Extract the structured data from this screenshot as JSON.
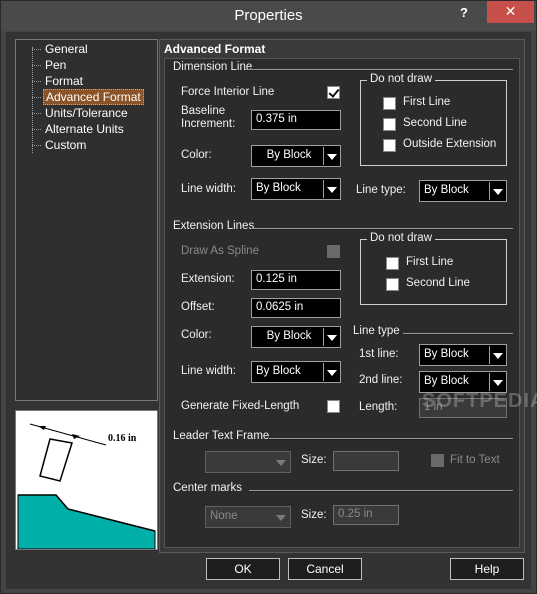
{
  "window": {
    "title": "Properties",
    "help_glyph": "?",
    "close_glyph": "✕"
  },
  "tree": {
    "items": [
      {
        "label": "General",
        "selected": false
      },
      {
        "label": "Pen",
        "selected": false
      },
      {
        "label": "Format",
        "selected": false
      },
      {
        "label": "Advanced Format",
        "selected": true
      },
      {
        "label": "Units/Tolerance",
        "selected": false
      },
      {
        "label": "Alternate Units",
        "selected": false
      },
      {
        "label": "Custom",
        "selected": false
      }
    ]
  },
  "preview": {
    "dimension_text": "0.16 in",
    "fill_color": "#00b0a8"
  },
  "panel": {
    "title": "Advanced Format",
    "dimension_line": {
      "heading": "Dimension Line",
      "force_interior_label": "Force Interior Line",
      "force_interior_checked": true,
      "baseline_label_1": "Baseline",
      "baseline_label_2": "Increment:",
      "baseline_value": "0.375 in",
      "color_label": "Color:",
      "color_value": "By Block",
      "line_width_label": "Line width:",
      "line_width_value": "By Block",
      "line_type_label": "Line type:",
      "line_type_value": "By Block",
      "do_not_draw": {
        "caption": "Do not draw",
        "first_line": "First Line",
        "second_line": "Second Line",
        "outside_extension": "Outside Extension"
      }
    },
    "extension_lines": {
      "heading": "Extension Lines",
      "draw_as_spline_label": "Draw As Spline",
      "extension_label": "Extension:",
      "extension_value": "0.125 in",
      "offset_label": "Offset:",
      "offset_value": "0.0625 in",
      "color_label": "Color:",
      "color_value": "By Block",
      "line_width_label": "Line width:",
      "line_width_value": "By Block",
      "generate_fixed_label": "Generate Fixed-Length",
      "do_not_draw": {
        "caption": "Do not draw",
        "first_line": "First Line",
        "second_line": "Second Line"
      },
      "line_type": {
        "caption": "Line type",
        "first_line_label": "1st line:",
        "first_line_value": "By Block",
        "second_line_label": "2nd line:",
        "second_line_value": "By Block",
        "length_label": "Length:",
        "length_value": "1 in"
      }
    },
    "leader_text_frame": {
      "heading": "Leader Text Frame",
      "size_label": "Size:",
      "fit_to_text_label": "Fit to Text"
    },
    "center_marks": {
      "heading": "Center marks",
      "type_value": "None",
      "size_label": "Size:",
      "size_value": "0.25 in"
    }
  },
  "buttons": {
    "ok": "OK",
    "cancel": "Cancel",
    "help": "Help"
  },
  "watermark": "SOFTPEDIA"
}
